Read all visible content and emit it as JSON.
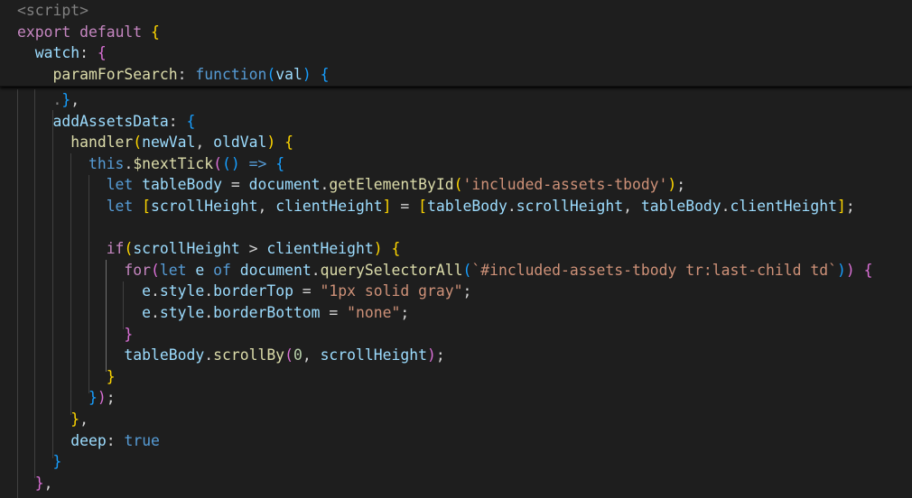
{
  "colors": {
    "background": "#1e1e1e",
    "keyword": "#569cd6",
    "control_keyword": "#c586c0",
    "property": "#9cdcfe",
    "function": "#dcdcaa",
    "string": "#ce9178",
    "number": "#b5cea8",
    "tag": "#808080",
    "bracket_level_1": "#ffd700",
    "bracket_level_2": "#da70d6",
    "bracket_level_3": "#179fff",
    "indent_guide": "#404040"
  },
  "sticky_scroll": {
    "lines": [
      {
        "tokens": [
          {
            "c": "tag",
            "t": "<script>"
          }
        ]
      },
      {
        "tokens": [
          {
            "c": "ctl",
            "t": "export"
          },
          {
            "c": "pn",
            "t": " "
          },
          {
            "c": "ctl",
            "t": "default"
          },
          {
            "c": "pn",
            "t": " "
          },
          {
            "c": "b1",
            "t": "{"
          }
        ]
      },
      {
        "tokens": [
          {
            "c": "pn",
            "t": "  "
          },
          {
            "c": "prop",
            "t": "watch"
          },
          {
            "c": "pn",
            "t": ": "
          },
          {
            "c": "b2",
            "t": "{"
          }
        ]
      },
      {
        "tokens": [
          {
            "c": "pn",
            "t": "    "
          },
          {
            "c": "fn",
            "t": "paramForSearch"
          },
          {
            "c": "pn",
            "t": ": "
          },
          {
            "c": "kw",
            "t": "function"
          },
          {
            "c": "b3",
            "t": "("
          },
          {
            "c": "vr",
            "t": "val"
          },
          {
            "c": "b3",
            "t": ")"
          },
          {
            "c": "pn",
            "t": " "
          },
          {
            "c": "b3",
            "t": "{"
          }
        ]
      }
    ]
  },
  "code_lines": [
    {
      "tokens": [
        {
          "c": "pn",
          "t": "    "
        },
        {
          "c": "fold",
          "t": "."
        },
        {
          "c": "b3",
          "t": "}"
        },
        {
          "c": "pn",
          "t": ","
        }
      ]
    },
    {
      "tokens": [
        {
          "c": "pn",
          "t": "    "
        },
        {
          "c": "prop",
          "t": "addAssetsData"
        },
        {
          "c": "pn",
          "t": ": "
        },
        {
          "c": "b3",
          "t": "{"
        }
      ]
    },
    {
      "tokens": [
        {
          "c": "pn",
          "t": "      "
        },
        {
          "c": "fn",
          "t": "handler"
        },
        {
          "c": "b1",
          "t": "("
        },
        {
          "c": "vr",
          "t": "newVal"
        },
        {
          "c": "pn",
          "t": ", "
        },
        {
          "c": "vr",
          "t": "oldVal"
        },
        {
          "c": "b1",
          "t": ")"
        },
        {
          "c": "pn",
          "t": " "
        },
        {
          "c": "b1",
          "t": "{"
        }
      ]
    },
    {
      "tokens": [
        {
          "c": "pn",
          "t": "        "
        },
        {
          "c": "kw",
          "t": "this"
        },
        {
          "c": "pn",
          "t": "."
        },
        {
          "c": "fn",
          "t": "$nextTick"
        },
        {
          "c": "b2",
          "t": "("
        },
        {
          "c": "b3",
          "t": "()"
        },
        {
          "c": "pn",
          "t": " "
        },
        {
          "c": "kw",
          "t": "=>"
        },
        {
          "c": "pn",
          "t": " "
        },
        {
          "c": "b3",
          "t": "{"
        }
      ]
    },
    {
      "tokens": [
        {
          "c": "pn",
          "t": "          "
        },
        {
          "c": "kw",
          "t": "let"
        },
        {
          "c": "pn",
          "t": " "
        },
        {
          "c": "vr",
          "t": "tableBody"
        },
        {
          "c": "pn",
          "t": " = "
        },
        {
          "c": "vr",
          "t": "document"
        },
        {
          "c": "pn",
          "t": "."
        },
        {
          "c": "fn",
          "t": "getElementById"
        },
        {
          "c": "b1",
          "t": "("
        },
        {
          "c": "str",
          "t": "'included-assets-tbody'"
        },
        {
          "c": "b1",
          "t": ")"
        },
        {
          "c": "pn",
          "t": ";"
        }
      ]
    },
    {
      "tokens": [
        {
          "c": "pn",
          "t": "          "
        },
        {
          "c": "kw",
          "t": "let"
        },
        {
          "c": "pn",
          "t": " "
        },
        {
          "c": "b1",
          "t": "["
        },
        {
          "c": "vr",
          "t": "scrollHeight"
        },
        {
          "c": "pn",
          "t": ", "
        },
        {
          "c": "vr",
          "t": "clientHeight"
        },
        {
          "c": "b1",
          "t": "]"
        },
        {
          "c": "pn",
          "t": " = "
        },
        {
          "c": "b1",
          "t": "["
        },
        {
          "c": "vr",
          "t": "tableBody"
        },
        {
          "c": "pn",
          "t": "."
        },
        {
          "c": "prop",
          "t": "scrollHeight"
        },
        {
          "c": "pn",
          "t": ", "
        },
        {
          "c": "vr",
          "t": "tableBody"
        },
        {
          "c": "pn",
          "t": "."
        },
        {
          "c": "prop",
          "t": "clientHeight"
        },
        {
          "c": "b1",
          "t": "]"
        },
        {
          "c": "pn",
          "t": ";"
        }
      ]
    },
    {
      "tokens": [
        {
          "c": "pn",
          "t": ""
        }
      ]
    },
    {
      "tokens": [
        {
          "c": "pn",
          "t": "          "
        },
        {
          "c": "ctl",
          "t": "if"
        },
        {
          "c": "b1",
          "t": "("
        },
        {
          "c": "vr",
          "t": "scrollHeight"
        },
        {
          "c": "pn",
          "t": " > "
        },
        {
          "c": "vr",
          "t": "clientHeight"
        },
        {
          "c": "b1",
          "t": ")"
        },
        {
          "c": "pn",
          "t": " "
        },
        {
          "c": "b1",
          "t": "{"
        }
      ]
    },
    {
      "tokens": [
        {
          "c": "pn",
          "t": "            "
        },
        {
          "c": "ctl",
          "t": "for"
        },
        {
          "c": "b2",
          "t": "("
        },
        {
          "c": "kw",
          "t": "let"
        },
        {
          "c": "pn",
          "t": " "
        },
        {
          "c": "vr",
          "t": "e"
        },
        {
          "c": "pn",
          "t": " "
        },
        {
          "c": "kw",
          "t": "of"
        },
        {
          "c": "pn",
          "t": " "
        },
        {
          "c": "vr",
          "t": "document"
        },
        {
          "c": "pn",
          "t": "."
        },
        {
          "c": "fn",
          "t": "querySelectorAll"
        },
        {
          "c": "b3",
          "t": "("
        },
        {
          "c": "str",
          "t": "`#included-assets-tbody tr:last-child td`"
        },
        {
          "c": "b3",
          "t": ")"
        },
        {
          "c": "b2",
          "t": ")"
        },
        {
          "c": "pn",
          "t": " "
        },
        {
          "c": "b2",
          "t": "{"
        }
      ]
    },
    {
      "tokens": [
        {
          "c": "pn",
          "t": "              "
        },
        {
          "c": "vr",
          "t": "e"
        },
        {
          "c": "pn",
          "t": "."
        },
        {
          "c": "vr",
          "t": "style"
        },
        {
          "c": "pn",
          "t": "."
        },
        {
          "c": "prop",
          "t": "borderTop"
        },
        {
          "c": "pn",
          "t": " = "
        },
        {
          "c": "str",
          "t": "\"1px solid gray\""
        },
        {
          "c": "pn",
          "t": ";"
        }
      ]
    },
    {
      "tokens": [
        {
          "c": "pn",
          "t": "              "
        },
        {
          "c": "vr",
          "t": "e"
        },
        {
          "c": "pn",
          "t": "."
        },
        {
          "c": "vr",
          "t": "style"
        },
        {
          "c": "pn",
          "t": "."
        },
        {
          "c": "prop",
          "t": "borderBottom"
        },
        {
          "c": "pn",
          "t": " = "
        },
        {
          "c": "str",
          "t": "\"none\""
        },
        {
          "c": "pn",
          "t": ";"
        }
      ]
    },
    {
      "tokens": [
        {
          "c": "pn",
          "t": "            "
        },
        {
          "c": "b2",
          "t": "}"
        }
      ]
    },
    {
      "tokens": [
        {
          "c": "pn",
          "t": "            "
        },
        {
          "c": "vr",
          "t": "tableBody"
        },
        {
          "c": "pn",
          "t": "."
        },
        {
          "c": "fn",
          "t": "scrollBy"
        },
        {
          "c": "b2",
          "t": "("
        },
        {
          "c": "num",
          "t": "0"
        },
        {
          "c": "pn",
          "t": ", "
        },
        {
          "c": "vr",
          "t": "scrollHeight"
        },
        {
          "c": "b2",
          "t": ")"
        },
        {
          "c": "pn",
          "t": ";"
        }
      ]
    },
    {
      "tokens": [
        {
          "c": "pn",
          "t": "          "
        },
        {
          "c": "b1",
          "t": "}"
        }
      ]
    },
    {
      "tokens": [
        {
          "c": "pn",
          "t": "        "
        },
        {
          "c": "b3",
          "t": "}"
        },
        {
          "c": "b2",
          "t": ")"
        },
        {
          "c": "pn",
          "t": ";"
        }
      ]
    },
    {
      "tokens": [
        {
          "c": "pn",
          "t": "      "
        },
        {
          "c": "b1",
          "t": "}"
        },
        {
          "c": "pn",
          "t": ","
        }
      ]
    },
    {
      "tokens": [
        {
          "c": "pn",
          "t": "      "
        },
        {
          "c": "prop",
          "t": "deep"
        },
        {
          "c": "pn",
          "t": ": "
        },
        {
          "c": "kw",
          "t": "true"
        }
      ]
    },
    {
      "tokens": [
        {
          "c": "pn",
          "t": "    "
        },
        {
          "c": "b3",
          "t": "}"
        }
      ]
    },
    {
      "tokens": [
        {
          "c": "pn",
          "t": "  "
        },
        {
          "c": "b2",
          "t": "}"
        },
        {
          "c": "pn",
          "t": ","
        }
      ]
    }
  ]
}
